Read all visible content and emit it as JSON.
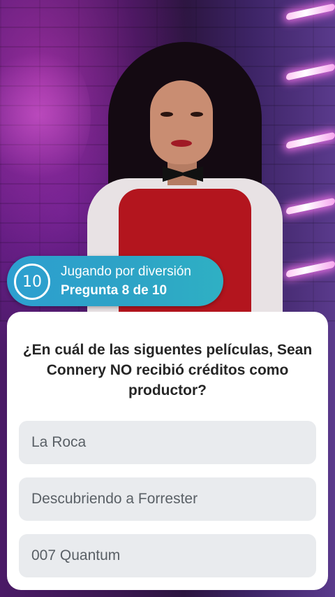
{
  "status": {
    "counter": "10",
    "mode": "Jugando por diversión",
    "progress": "Pregunta 8 de 10",
    "color": "#2da3c6"
  },
  "question": {
    "text": "¿En cuál de las siguentes películas, Sean Connery NO recibió créditos como productor?"
  },
  "answers": [
    {
      "label": "La Roca"
    },
    {
      "label": "Descubriendo a Forrester"
    },
    {
      "label": "007 Quantum"
    }
  ]
}
